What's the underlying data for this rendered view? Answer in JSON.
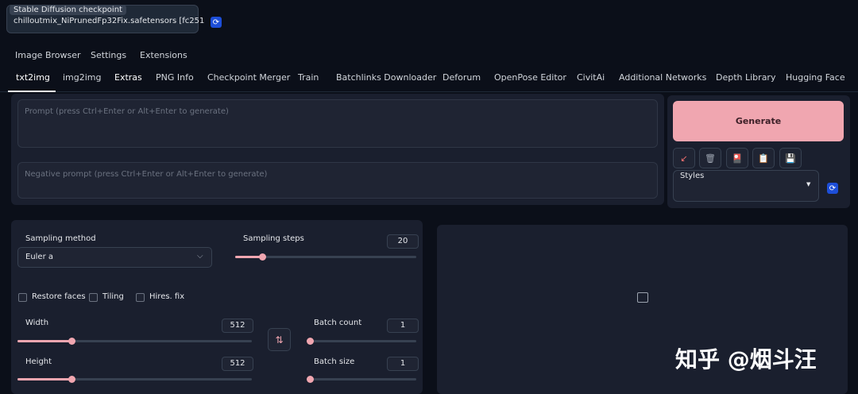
{
  "checkpoint": {
    "label": "Stable Diffusion checkpoint",
    "value": "chilloutmix_NiPrunedFp32Fix.safetensors [fc251",
    "refresh_icon": "refresh-icon"
  },
  "top_tabs": [
    "Image Browser",
    "Settings",
    "Extensions"
  ],
  "tabs": [
    "txt2img",
    "img2img",
    "Extras",
    "PNG Info",
    "Checkpoint Merger",
    "Train",
    "Batchlinks Downloader",
    "Deforum",
    "OpenPose Editor",
    "CivitAi",
    "Additional Networks",
    "Depth Library",
    "Hugging Face"
  ],
  "active_tab": "txt2img",
  "prompt": {
    "placeholder": "Prompt (press Ctrl+Enter or Alt+Enter to generate)"
  },
  "negative_prompt": {
    "placeholder": "Negative prompt (press Ctrl+Enter or Alt+Enter to generate)"
  },
  "generate": {
    "label": "Generate"
  },
  "tools": [
    {
      "icon": "arrow-icon",
      "glyph": "↙"
    },
    {
      "icon": "trash-icon",
      "glyph": "🗑"
    },
    {
      "icon": "style-icon",
      "glyph": "🎴"
    },
    {
      "icon": "clipboard-icon",
      "glyph": "📋"
    },
    {
      "icon": "save-icon",
      "glyph": "💾"
    }
  ],
  "styles": {
    "label": "Styles"
  },
  "sampling_method": {
    "label": "Sampling method",
    "value": "Euler a"
  },
  "sampling_steps": {
    "label": "Sampling steps",
    "value": "20",
    "fraction": 0.15
  },
  "checkboxes": [
    "Restore faces",
    "Tiling",
    "Hires. fix"
  ],
  "width": {
    "label": "Width",
    "value": "512",
    "fraction": 0.23
  },
  "height": {
    "label": "Height",
    "value": "512",
    "fraction": 0.23
  },
  "batch_count": {
    "label": "Batch count",
    "value": "1",
    "fraction": 0.0
  },
  "batch_size": {
    "label": "Batch size",
    "value": "1",
    "fraction": 0.0
  },
  "watermark": "知乎 @烟斗汪",
  "colors": {
    "accent": "#f0a6b0",
    "background": "#0b0f19",
    "panel": "#1a1f2e"
  }
}
